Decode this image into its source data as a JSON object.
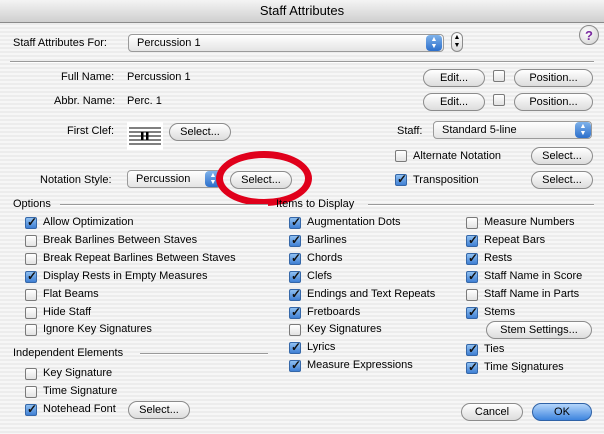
{
  "window": {
    "title": "Staff Attributes"
  },
  "header": {
    "for_label": "Staff Attributes For:",
    "staff_value": "Percussion 1",
    "help_glyph": "?"
  },
  "names": {
    "full_name_label": "Full Name:",
    "full_name_value": "Percussion 1",
    "abbr_name_label": "Abbr. Name:",
    "abbr_name_value": "Perc. 1",
    "edit_label": "Edit...",
    "position_label": "Position..."
  },
  "clef": {
    "label": "First Clef:",
    "select_label": "Select..."
  },
  "staff": {
    "label": "Staff:",
    "value": "Standard 5-line",
    "alternate_label": "Alternate Notation",
    "transposition_label": "Transposition",
    "select_label": "Select..."
  },
  "notation": {
    "label": "Notation Style:",
    "value": "Percussion",
    "select_label": "Select..."
  },
  "options": {
    "heading": "Options",
    "items": [
      {
        "label": "Allow Optimization",
        "checked": true
      },
      {
        "label": "Break Barlines Between Staves",
        "checked": false
      },
      {
        "label": "Break Repeat Barlines Between Staves",
        "checked": false
      },
      {
        "label": "Display Rests in Empty Measures",
        "checked": true
      },
      {
        "label": "Flat Beams",
        "checked": false
      },
      {
        "label": "Hide Staff",
        "checked": false
      },
      {
        "label": "Ignore Key Signatures",
        "checked": false
      }
    ]
  },
  "independent": {
    "heading": "Independent Elements",
    "items": [
      {
        "label": "Key Signature",
        "checked": false
      },
      {
        "label": "Time Signature",
        "checked": false
      },
      {
        "label": "Notehead Font",
        "checked": true
      }
    ],
    "select_label": "Select..."
  },
  "display": {
    "heading": "Items to Display",
    "col1": [
      {
        "label": "Augmentation Dots",
        "checked": true
      },
      {
        "label": "Barlines",
        "checked": true
      },
      {
        "label": "Chords",
        "checked": true
      },
      {
        "label": "Clefs",
        "checked": true
      },
      {
        "label": "Endings and Text Repeats",
        "checked": true
      },
      {
        "label": "Fretboards",
        "checked": true
      },
      {
        "label": "Key Signatures",
        "checked": false
      },
      {
        "label": "Lyrics",
        "checked": true
      },
      {
        "label": "Measure Expressions",
        "checked": true
      }
    ],
    "col2": [
      {
        "label": "Measure Numbers",
        "checked": false
      },
      {
        "label": "Repeat Bars",
        "checked": true
      },
      {
        "label": "Rests",
        "checked": true
      },
      {
        "label": "Staff Name in Score",
        "checked": true
      },
      {
        "label": "Staff Name in Parts",
        "checked": false
      },
      {
        "label": "Stems",
        "checked": true
      },
      {
        "label": "Ties",
        "checked": true
      },
      {
        "label": "Time Signatures",
        "checked": true
      }
    ],
    "stem_settings_label": "Stem Settings..."
  },
  "footer": {
    "cancel_label": "Cancel",
    "ok_label": "OK"
  },
  "colors": {
    "accent": "#3d84de",
    "annotation_ring": "#e0001b"
  }
}
